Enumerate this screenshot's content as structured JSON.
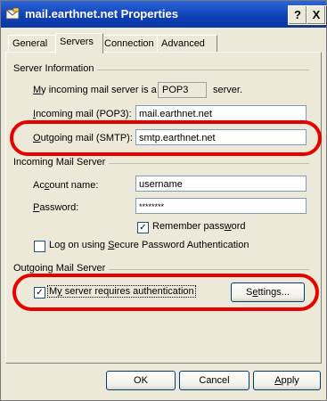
{
  "window": {
    "title": "mail.earthnet.net Properties",
    "help_label": "?",
    "close_label": "X"
  },
  "tabs": [
    {
      "label": "General"
    },
    {
      "label": "Servers",
      "active": true
    },
    {
      "label": "Connection"
    },
    {
      "label": "Advanced"
    }
  ],
  "server_info": {
    "heading": "Server Information",
    "incoming_type_prefix_underlined": "M",
    "incoming_type_prefix_rest": "y incoming mail server is a",
    "incoming_type_value": "POP3",
    "incoming_type_suffix": "server.",
    "incoming_label_u": "I",
    "incoming_label_rest": "ncoming mail (POP3):",
    "incoming_value": "mail.earthnet.net",
    "outgoing_label_u": "O",
    "outgoing_label_rest": "utgoing mail (SMTP):",
    "outgoing_value": "smtp.earthnet.net"
  },
  "incoming_server": {
    "heading": "Incoming Mail Server",
    "account_label_pre": "Ac",
    "account_label_u": "c",
    "account_label_rest": "ount name:",
    "account_value": "username",
    "password_label_u": "P",
    "password_label_rest": "assword:",
    "password_value": "********",
    "remember_label_pre": "Remember pass",
    "remember_label_u": "w",
    "remember_label_rest": "ord",
    "remember_checked": true,
    "spa_label_pre": "Log on using ",
    "spa_label_u": "S",
    "spa_label_rest": "ecure Password Authentication",
    "spa_checked": false
  },
  "outgoing_server": {
    "heading": "Outgoing Mail Server",
    "auth_label_pre": "M",
    "auth_label_u": "y",
    "auth_label_rest": " server requires authentication",
    "auth_checked": true,
    "settings_label_pre": "S",
    "settings_label_u": "e",
    "settings_label_rest": "ttings..."
  },
  "footer": {
    "ok_label": "OK",
    "cancel_label": "Cancel",
    "apply_label_u": "A",
    "apply_label_rest": "pply"
  },
  "colors": {
    "highlight": "#e80000",
    "titlebar": "#0d3fb5",
    "dialog_bg": "#ECE9D8"
  }
}
